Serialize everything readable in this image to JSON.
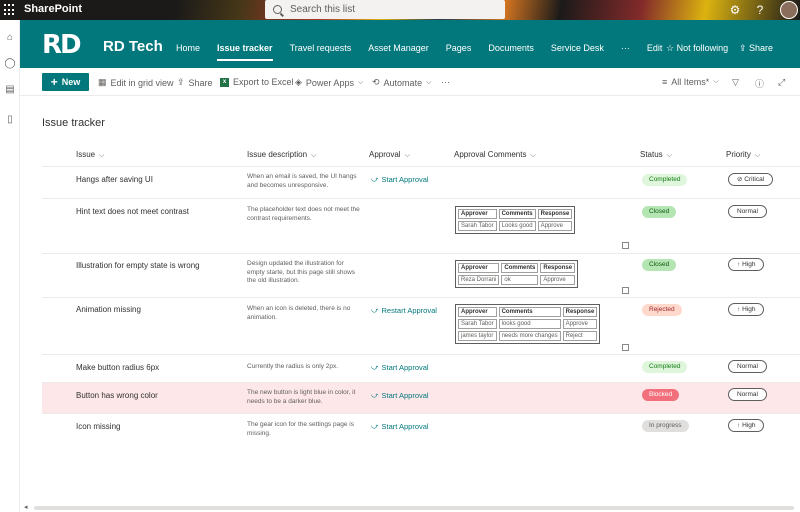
{
  "suite": {
    "brand": "SharePoint",
    "search_placeholder": "Search this list",
    "settings_icon": "gear-icon",
    "help_icon": "help-icon"
  },
  "rail": {
    "icons": [
      "home-icon",
      "globe-icon",
      "news-icon",
      "document-icon"
    ]
  },
  "site": {
    "logo": "RD",
    "name": "RD Tech",
    "accent": "#03787c",
    "nav": [
      "Home",
      "Issue tracker",
      "Travel requests",
      "Asset Manager",
      "Pages",
      "Documents",
      "Service Desk",
      "···",
      "Edit"
    ],
    "active_nav": "Issue tracker",
    "follow": "Not following",
    "share": "Share"
  },
  "commands": {
    "new": "New",
    "grid": "Edit in grid view",
    "share": "Share",
    "excel": "Export to Excel",
    "powerapps": "Power Apps",
    "automate": "Automate",
    "more": "···",
    "view": "All Items*"
  },
  "list": {
    "title": "Issue tracker",
    "columns": [
      "Issue",
      "Issue description",
      "Approval",
      "Approval Comments",
      "Status",
      "Priority"
    ],
    "mini_headers": [
      "Approver",
      "Comments",
      "Response"
    ],
    "rows": [
      {
        "issue": "Hangs after saving UI",
        "desc": "When an email is saved, the UI hangs and becomes unresponsive.",
        "approval": "Start Approval",
        "comments": [],
        "status": "Completed",
        "priority": "Critical",
        "highlight": false
      },
      {
        "issue": "Hint text does not meet contrast",
        "desc": "The placeholder text does not meet the contrast requirements.",
        "approval": "",
        "comments": [
          [
            "Sarah Tabor",
            "Looks good",
            "Approve"
          ]
        ],
        "status": "Closed",
        "priority": "Normal",
        "highlight": false
      },
      {
        "issue": "Illustration for empty state is wrong",
        "desc": "Design updated the illustration for empty starte, but this page still shows the old illustration.",
        "approval": "",
        "comments": [
          [
            "Reza Dorrani",
            "ok",
            "Approve"
          ]
        ],
        "status": "Closed",
        "priority": "High",
        "highlight": false
      },
      {
        "issue": "Animation missing",
        "desc": "When an icon is deleted, there is no animation.",
        "approval": "Restart Approval",
        "comments": [
          [
            "Sarah Tabor",
            "looks good",
            "Approve"
          ],
          [
            "james taylor",
            "needs more changes",
            "Reject"
          ]
        ],
        "status": "Rejected",
        "priority": "High",
        "highlight": false
      },
      {
        "issue": "Make button radius 6px",
        "desc": "Currently the radius is only 2px.",
        "approval": "Start Approval",
        "comments": [],
        "status": "Completed",
        "priority": "Normal",
        "highlight": false
      },
      {
        "issue": "Button has wrong color",
        "desc": "The new button is light blue in color, it needs to be a darker blue.",
        "approval": "Start Approval",
        "comments": [],
        "status": "Blocked",
        "priority": "Normal",
        "highlight": true
      },
      {
        "issue": "Icon missing",
        "desc": "The gear icon for the settings page is missing.",
        "approval": "Start Approval",
        "comments": [],
        "status": "In progress",
        "priority": "High",
        "highlight": false
      }
    ]
  }
}
